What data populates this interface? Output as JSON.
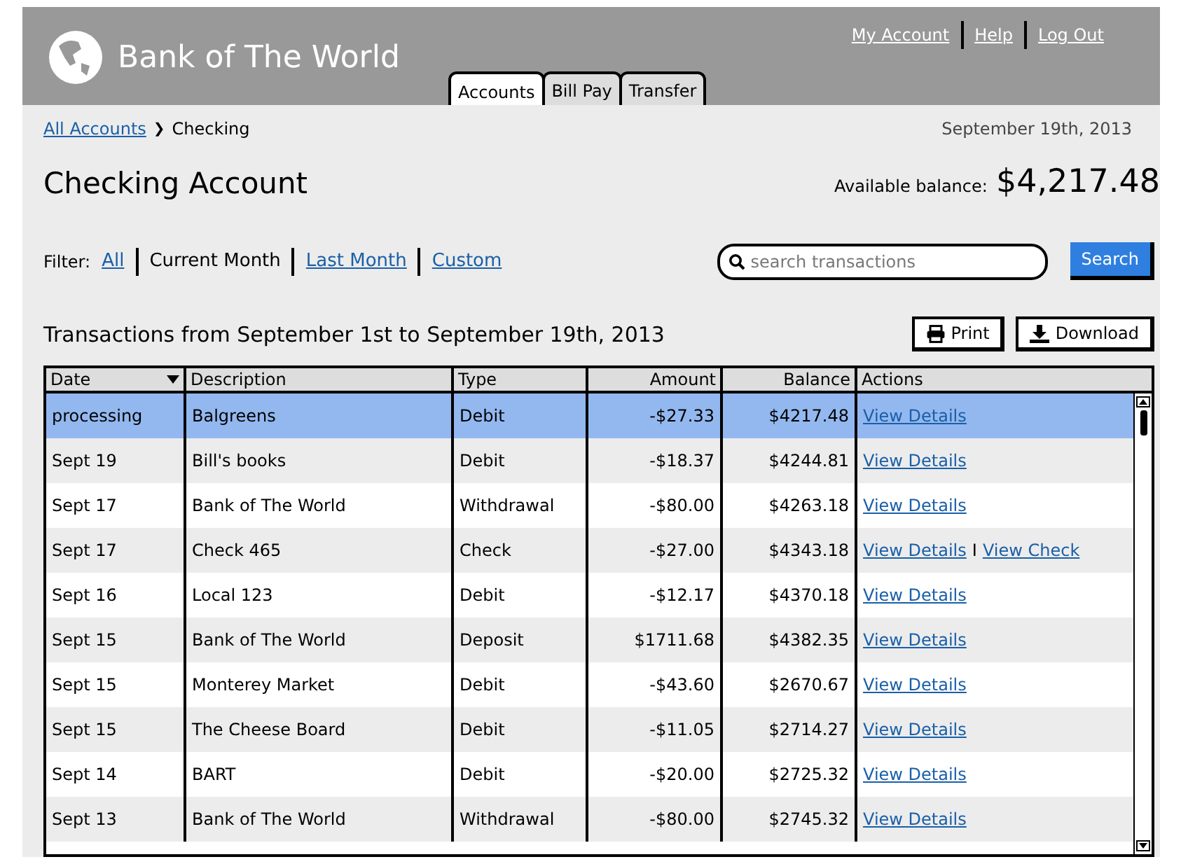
{
  "header": {
    "brand": "Bank of The World",
    "tabs": [
      {
        "label": "Accounts",
        "selected": true
      },
      {
        "label": "Bill Pay",
        "selected": false
      },
      {
        "label": "Transfer",
        "selected": false
      }
    ],
    "links": [
      "My Account",
      "Help",
      "Log Out"
    ]
  },
  "breadcrumb": {
    "link": "All Accounts",
    "separator": "❯",
    "current": "Checking"
  },
  "date": "September 19th, 2013",
  "title": "Checking Account",
  "balance": {
    "label": "Available balance:",
    "value": "$4,217.48"
  },
  "filter": {
    "label": "Filter:",
    "options": [
      {
        "label": "All",
        "selected": false
      },
      {
        "label": "Current Month",
        "selected": true
      },
      {
        "label": "Last Month",
        "selected": false
      },
      {
        "label": "Custom",
        "selected": false
      }
    ]
  },
  "search": {
    "placeholder": "search transactions",
    "button": "Search"
  },
  "caption": "Transactions from September 1st to September 19th, 2013",
  "actions": [
    "Print",
    "Download"
  ],
  "table": {
    "columns": [
      "Date",
      "Description",
      "Type",
      "Amount",
      "Balance",
      "Actions"
    ],
    "rows": [
      {
        "selected": true,
        "cells": [
          "processing",
          "Balgreens",
          "Debit",
          "-$27.33",
          "$4217.48"
        ],
        "actions": [
          "View Details"
        ]
      },
      {
        "selected": false,
        "cells": [
          "Sept 19",
          "Bill's books",
          "Debit",
          "-$18.37",
          "$4244.81"
        ],
        "actions": [
          "View Details"
        ]
      },
      {
        "selected": false,
        "cells": [
          "Sept 17",
          "Bank of The World",
          "Withdrawal",
          "-$80.00",
          "$4263.18"
        ],
        "actions": [
          "View Details"
        ]
      },
      {
        "selected": false,
        "cells": [
          "Sept 17",
          "Check 465",
          "Check",
          "-$27.00",
          "$4343.18"
        ],
        "actions": [
          "View Details",
          "View Check"
        ],
        "action_separator": "I"
      },
      {
        "selected": false,
        "cells": [
          "Sept 16",
          "Local 123",
          "Debit",
          "-$12.17",
          "$4370.18"
        ],
        "actions": [
          "View Details"
        ]
      },
      {
        "selected": false,
        "cells": [
          "Sept 15",
          "Bank of The World",
          "Deposit",
          "$1711.68",
          "$4382.35"
        ],
        "actions": [
          "View Details"
        ]
      },
      {
        "selected": false,
        "cells": [
          "Sept 15",
          "Monterey Market",
          "Debit",
          "-$43.60",
          "$2670.67"
        ],
        "actions": [
          "View Details"
        ]
      },
      {
        "selected": false,
        "cells": [
          "Sept 15",
          "The Cheese Board",
          "Debit",
          "-$11.05",
          "$2714.27"
        ],
        "actions": [
          "View Details"
        ]
      },
      {
        "selected": false,
        "cells": [
          "Sept 14",
          "BART",
          "Debit",
          "-$20.00",
          "$2725.32"
        ],
        "actions": [
          "View Details"
        ]
      },
      {
        "selected": false,
        "cells": [
          "Sept 13",
          "Bank of The World",
          "Withdrawal",
          "-$80.00",
          "$2745.32"
        ],
        "actions": [
          "View Details"
        ]
      }
    ]
  }
}
